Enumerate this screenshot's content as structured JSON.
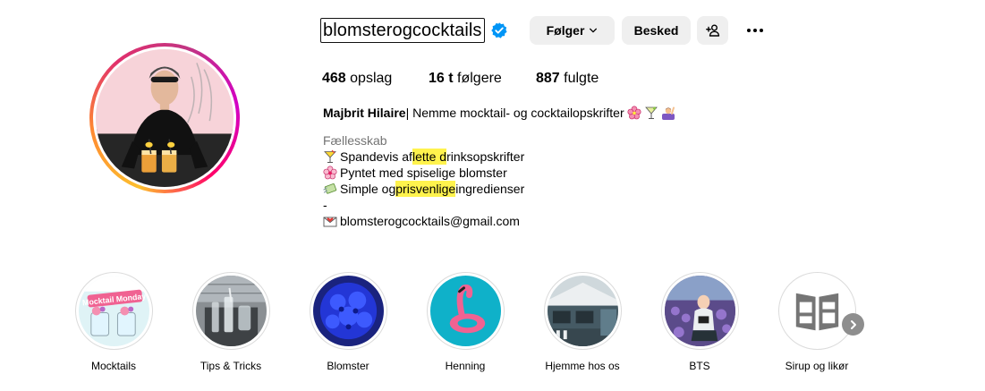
{
  "profile": {
    "username": "blomsterogcocktails",
    "follow_label": "Følger",
    "message_label": "Besked",
    "stats": {
      "posts_count": "468",
      "posts_label": " opslag",
      "followers_count": "16 t",
      "followers_label": " følgere",
      "following_count": "887",
      "following_label": " fulgte"
    },
    "bio": {
      "name": "Majbrit Hilaire",
      "headline": " | Nemme mocktail- og cocktailopskrifter",
      "category": "Fællesskab",
      "line1_pre": "Spandevis af ",
      "line1_hl": "lette d",
      "line1_post": "rinksopskrifter",
      "line2": "Pyntet med spiselige blomster",
      "line3_pre": "Simple og ",
      "line3_hl": "prisvenlige",
      "line3_post": " ingredienser",
      "dash": "-",
      "email": "blomsterogcocktails@gmail.com"
    },
    "colors": {
      "verified": "#0095f6",
      "highlight": "#fff34d",
      "button_bg": "#efefef",
      "category": "#737373"
    }
  },
  "highlights": [
    {
      "label": "Mocktails"
    },
    {
      "label": "Tips & Tricks"
    },
    {
      "label": "Blomster"
    },
    {
      "label": "Henning"
    },
    {
      "label": "Hjemme hos os"
    },
    {
      "label": "BTS"
    },
    {
      "label": "Sirup og likør"
    }
  ],
  "highlight_thumbnail_text": {
    "mocktails": "Mocktail Monday"
  },
  "icons": {
    "verified": "verified-badge-icon",
    "follow_chevron": "chevron-down-icon",
    "suggest": "add-person-icon",
    "more": "more-dots-icon",
    "next": "chevron-right-icon"
  }
}
